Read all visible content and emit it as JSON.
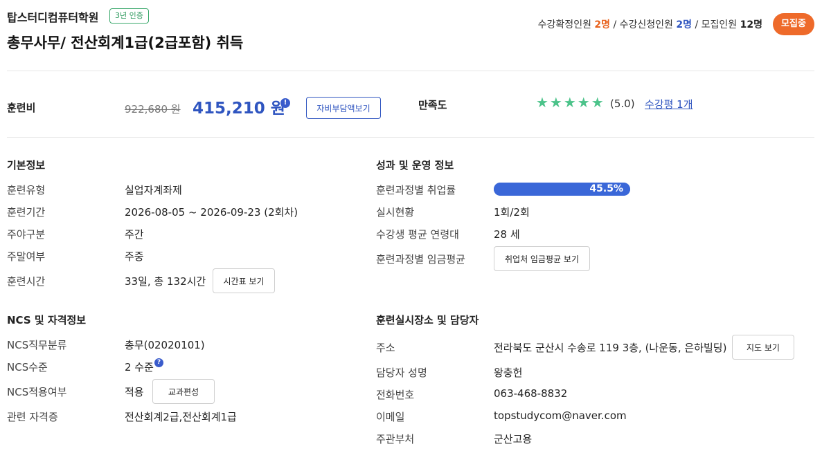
{
  "header": {
    "institution": "탑스터디컴퓨터학원",
    "cert_badge": "3년 인증",
    "course_title": "총무사무/ 전산회계1급(2급포함) 취득",
    "enroll": {
      "confirmed_label": "수강확정인원",
      "confirmed_value": "2명",
      "applied_label": "수강신청인원",
      "applied_value": "2명",
      "capacity_label": "모집인원",
      "capacity_value": "12명",
      "separator": "/"
    },
    "status_badge": "모집중"
  },
  "fee": {
    "label": "훈련비",
    "original_price": "922,680 원",
    "price": "415,210 원",
    "info_icon": "!",
    "self_pay_button": "자비부담액보기",
    "satisfaction_label": "만족도",
    "stars": "★★★★★",
    "star_count": 5,
    "rating": "(5.0)",
    "reviews_link": "수강평 1개",
    "star_color": "#4cc38a"
  },
  "basic_info": {
    "title": "기본정보",
    "rows": [
      {
        "label": "훈련유형",
        "value": "실업자계좌제"
      },
      {
        "label": "훈련기간",
        "value": "2026-08-05 ~ 2026-09-23 (2회차)"
      },
      {
        "label": "주야구분",
        "value": "주간"
      },
      {
        "label": "주말여부",
        "value": "주중"
      },
      {
        "label": "훈련시간",
        "value": "33일, 총 132시간",
        "button": "시간표 보기"
      }
    ]
  },
  "performance": {
    "title": "성과 및 운영 정보",
    "employment_label": "훈련과정별 취업률",
    "employment_rate": 45.5,
    "employment_text": "45.5%",
    "rows": [
      {
        "label": "실시현황",
        "value": "1회/2회"
      },
      {
        "label": "수강생 평균 연령대",
        "value": "28 세"
      }
    ],
    "wage_label": "훈련과정별 임금평균",
    "wage_button": "취업처 임금평균 보기",
    "bar_color": "#3a67d8"
  },
  "ncs": {
    "title": "NCS 및 자격정보",
    "rows": [
      {
        "label": "NCS직무분류",
        "value": "총무(02020101)"
      },
      {
        "label": "NCS수준",
        "value": "2 수준"
      },
      {
        "label": "NCS적용여부",
        "value": "적용",
        "button": "교과편성"
      },
      {
        "label": "관련 자격증",
        "value": "전산회계2급,전산회계1급"
      }
    ],
    "help_icon": "?"
  },
  "location": {
    "title": "훈련실시장소 및 담당자",
    "rows": [
      {
        "label": "주소",
        "value": "전라북도 군산시 수송로 119 3층, (나운동, 은하빌딩)",
        "button": "지도 보기"
      },
      {
        "label": "담당자 성명",
        "value": "왕충헌"
      },
      {
        "label": "전화번호",
        "value": "063-468-8832"
      },
      {
        "label": "이메일",
        "value": "topstudycom@naver.com"
      },
      {
        "label": "주관부처",
        "value": "군산고용"
      }
    ]
  },
  "colors": {
    "accent_blue": "#2f55c0",
    "accent_orange": "#ee6a2a",
    "cert_green": "#2e9a5e"
  }
}
